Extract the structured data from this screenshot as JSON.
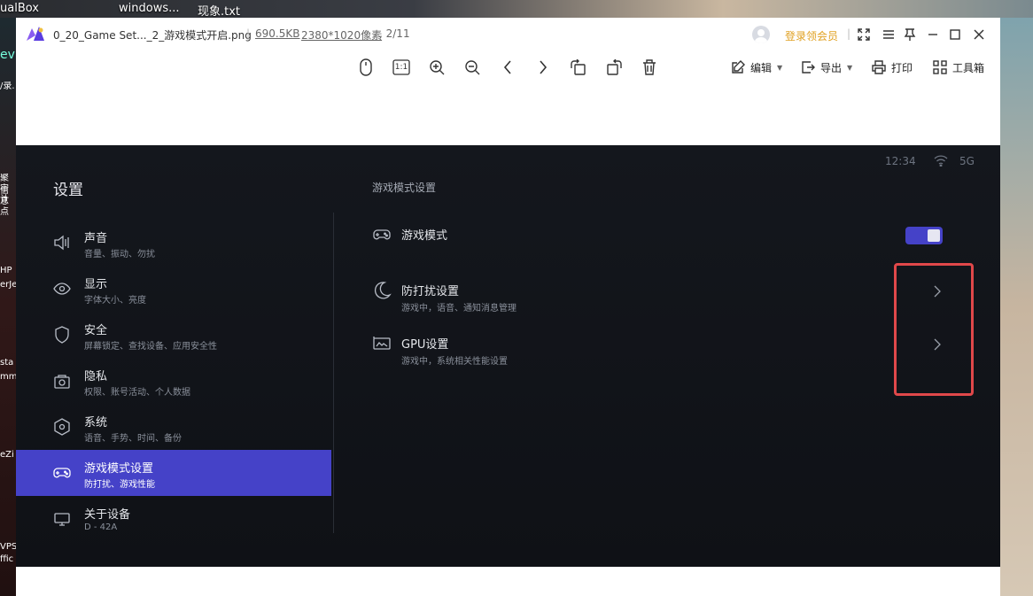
{
  "desktop": {
    "top_labels": [
      "ualBox",
      "windows...",
      "现象.txt"
    ],
    "left_icons": [
      "ev",
      "/录.",
      "聚审计",
      "信息点",
      "HP",
      "erJe",
      "sta",
      "mmu",
      "eZi",
      "VPS",
      "ffic"
    ]
  },
  "viewer": {
    "file_name": "0_20_Game Set..._2_游戏模式开启.png",
    "file_size": "690.5KB",
    "file_resolution": "2380*1020像素",
    "file_index": ", 2/11",
    "vip_link": "登录领会员",
    "toolbar": {
      "zoom_ratio_label": "1:1",
      "edit_label": "编辑",
      "export_label": "导出",
      "print_label": "打印",
      "toolbox_label": "工具箱"
    }
  },
  "screen": {
    "status": {
      "time": "12:34",
      "network": "5G"
    },
    "settings_title": "设置",
    "menu": [
      {
        "label": "声音",
        "sub": "音量、振动、勿扰"
      },
      {
        "label": "显示",
        "sub": "字体大小、亮度"
      },
      {
        "label": "安全",
        "sub": "屏幕锁定、查找设备、应用安全性"
      },
      {
        "label": "隐私",
        "sub": "权限、账号活动、个人数据"
      },
      {
        "label": "系统",
        "sub": "语音、手势、时间、备份"
      },
      {
        "label": "游戏模式设置",
        "sub": "防打扰、游戏性能",
        "active": true
      },
      {
        "label": "关于设备",
        "sub": "D - 42A"
      }
    ],
    "panel": {
      "title": "游戏模式设置",
      "game_mode_label": "游戏模式",
      "game_mode_on": true,
      "dnd_label": "防打扰设置",
      "dnd_sub": "游戏中，语音、通知消息管理",
      "gpu_label": "GPU设置",
      "gpu_sub": "游戏中，系统相关性能设置"
    }
  },
  "colors": {
    "accent": "#4542c8",
    "highlight_border": "#e0484a",
    "screen_bg": "#14171d",
    "vip_text": "#e0a020"
  }
}
